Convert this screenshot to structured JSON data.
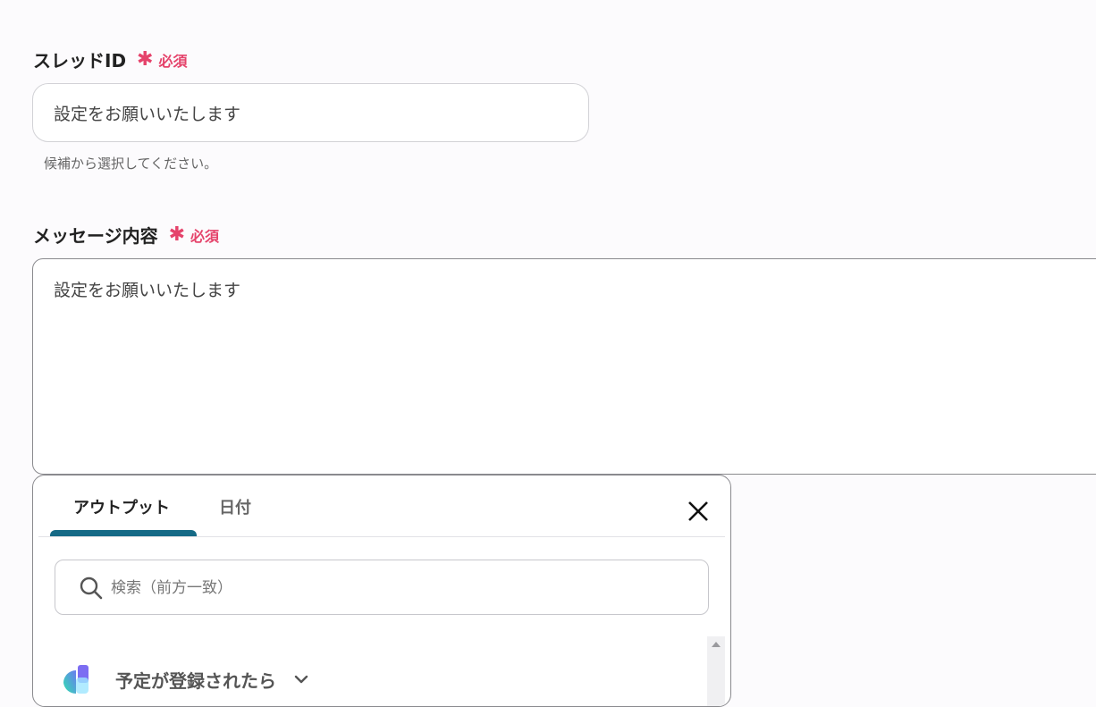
{
  "thread_field": {
    "label": "スレッドID",
    "required_mark": "✱",
    "required_text": "必須",
    "value": "設定をお願いいたします",
    "help": "候補から選択してください。"
  },
  "message_field": {
    "label": "メッセージ内容",
    "required_mark": "✱",
    "required_text": "必須",
    "value": "設定をお願いいたします"
  },
  "panel": {
    "tabs": [
      {
        "label": "アウトプット",
        "active": true
      },
      {
        "label": "日付",
        "active": false
      }
    ],
    "search": {
      "placeholder": "検索（前方一致）",
      "value": ""
    },
    "items": [
      {
        "label": "予定が登録されたら",
        "icon": "calendar-app-icon"
      }
    ]
  },
  "colors": {
    "required": "#e5436b",
    "tab_accent": "#156a86"
  }
}
